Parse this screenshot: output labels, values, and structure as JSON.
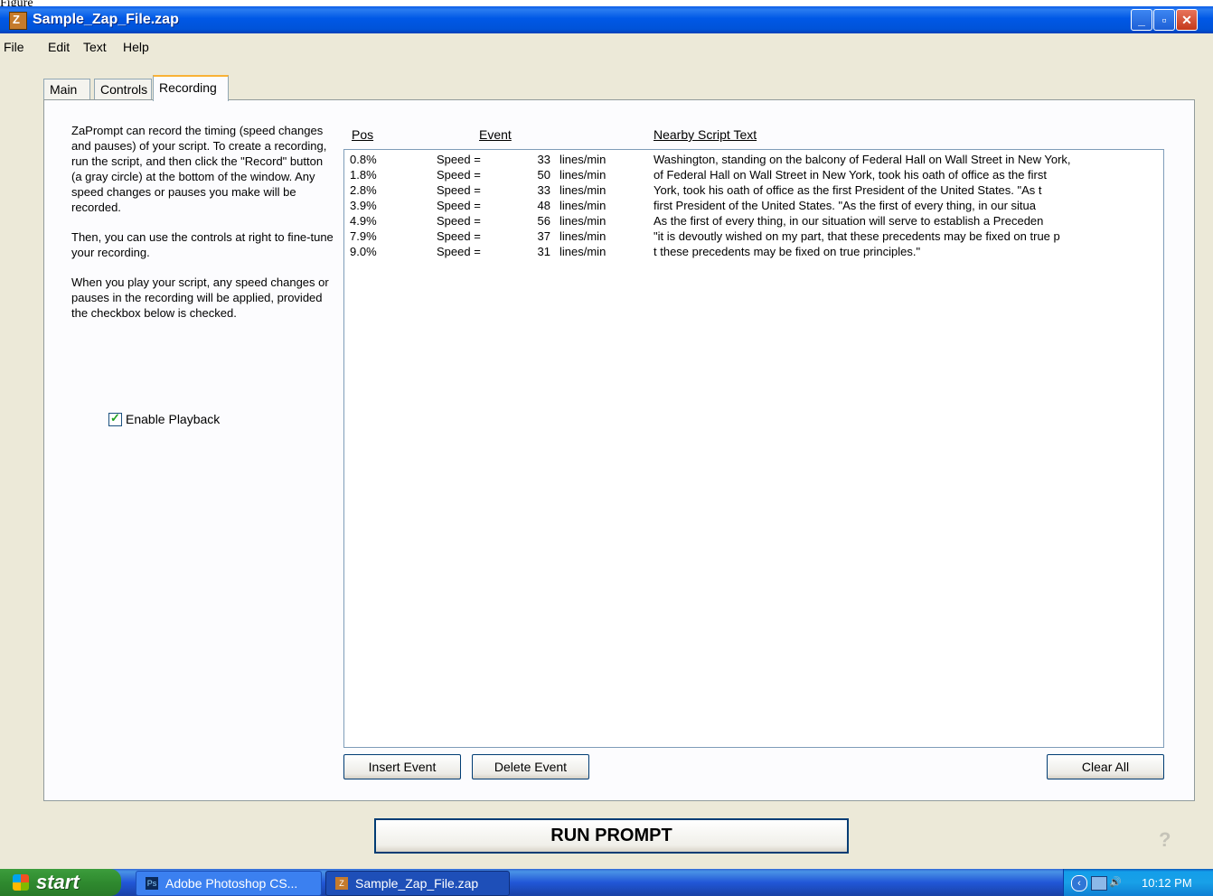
{
  "figure_label": "Figure",
  "window": {
    "title": "Sample_Zap_File.zap",
    "controls": {
      "minimize": "_",
      "maximize": "▫",
      "close": "✕"
    }
  },
  "menu": [
    "File",
    "Edit",
    "Text",
    "Help"
  ],
  "tabs": [
    {
      "label": "Main",
      "active": false
    },
    {
      "label": "Controls",
      "active": false
    },
    {
      "label": "Recording",
      "active": true
    }
  ],
  "help": {
    "para1": "ZaPrompt can record the timing (speed changes and pauses) of your script.  To create a recording, run the script, and then click the \"Record\" button (a gray circle) at the bottom of the window.  Any speed changes or pauses you make will be recorded.",
    "para2": "Then, you can use the controls at right to fine-tune your recording.",
    "para3": "When you play your script, any speed changes or pauses in the recording will be applied, provided the checkbox below is checked."
  },
  "playback": {
    "label": "Enable Playback",
    "checked": true
  },
  "columns": {
    "pos": "Pos",
    "event": "Event",
    "nearby": "Nearby Script Text"
  },
  "events": [
    {
      "pos": "0.8%",
      "event": "Speed =",
      "value": "33",
      "unit": "lines/min",
      "nearby": "Washington, standing on the balcony of Federal Hall on Wall Street in New York,"
    },
    {
      "pos": "1.8%",
      "event": "Speed =",
      "value": "50",
      "unit": "lines/min",
      "nearby": "of Federal Hall on Wall Street in New York, took his oath of office as the first"
    },
    {
      "pos": "2.8%",
      "event": "Speed =",
      "value": "33",
      "unit": "lines/min",
      "nearby": "York, took his oath of office as the first President of the United States. \"As t"
    },
    {
      "pos": "3.9%",
      "event": "Speed =",
      "value": "48",
      "unit": "lines/min",
      "nearby": "first President of the United States. \"As the first of every thing, in our situa"
    },
    {
      "pos": "4.9%",
      "event": "Speed =",
      "value": "56",
      "unit": "lines/min",
      "nearby": "As the first of every thing, in our situation will serve to establish a Preceden"
    },
    {
      "pos": "7.9%",
      "event": "Speed =",
      "value": "37",
      "unit": "lines/min",
      "nearby": " \"it is devoutly wished on my part, that these precedents may be fixed on true p"
    },
    {
      "pos": "9.0%",
      "event": "Speed =",
      "value": "31",
      "unit": "lines/min",
      "nearby": "t these precedents may be fixed on true principles.\""
    }
  ],
  "buttons": {
    "insert": "Insert Event",
    "delete": "Delete Event",
    "clear": "Clear All",
    "run": "RUN PROMPT",
    "help": "?"
  },
  "taskbar": {
    "start": "start",
    "items": [
      {
        "label": "Adobe Photoshop CS...",
        "icon": "Ps",
        "active": false
      },
      {
        "label": "Sample_Zap_File.zap",
        "icon": "Z",
        "active": true
      }
    ],
    "clock": "10:12 PM"
  },
  "colors": {
    "titlebar": "#0058e6",
    "tab_accent": "#f9b236",
    "taskbar": "#2157d7",
    "start_green": "#3c9d3c"
  }
}
